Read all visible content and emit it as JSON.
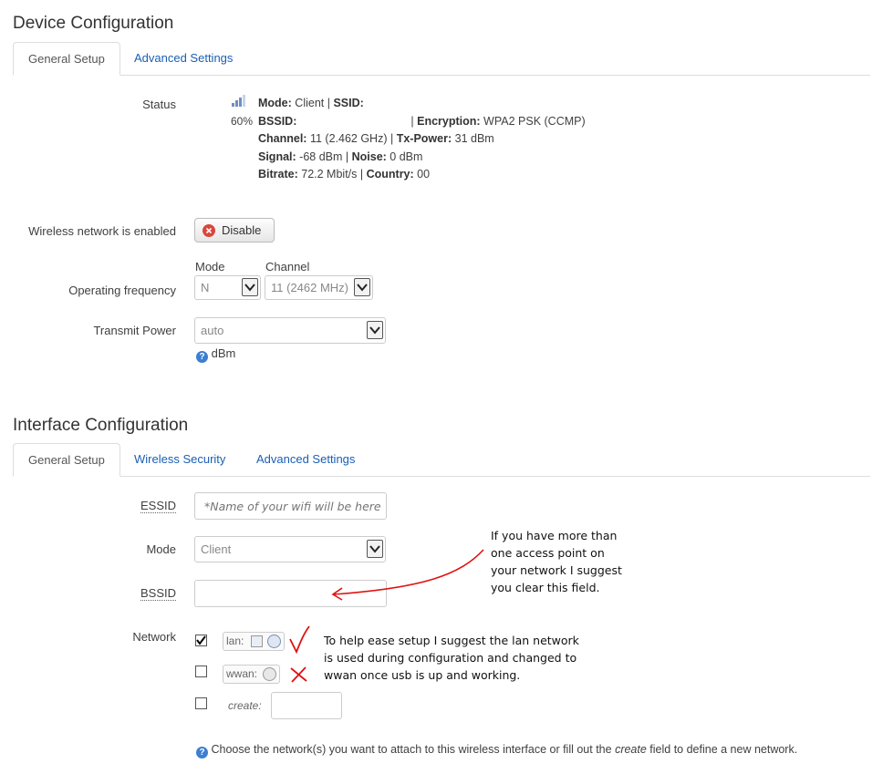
{
  "device": {
    "title": "Device Configuration",
    "tabs": [
      "General Setup",
      "Advanced Settings"
    ],
    "status": {
      "label": "Status",
      "signal_percent": "60%",
      "mode_label": "Mode:",
      "mode_value": "Client",
      "ssid_label": "SSID:",
      "bssid_label": "BSSID:",
      "encryption_label": "Encryption:",
      "encryption_value": "WPA2 PSK (CCMP)",
      "channel_label": "Channel:",
      "channel_value": "11 (2.462 GHz)",
      "txpower_label": "Tx-Power:",
      "txpower_value": "31 dBm",
      "signal_label": "Signal:",
      "signal_value": "-68 dBm",
      "noise_label": "Noise:",
      "noise_value": "0 dBm",
      "bitrate_label": "Bitrate:",
      "bitrate_value": "72.2 Mbit/s",
      "country_label": "Country:",
      "country_value": "00"
    },
    "wireless_enabled": {
      "label": "Wireless network is enabled",
      "button": "Disable"
    },
    "frequency": {
      "label": "Operating frequency",
      "mode_header": "Mode",
      "mode_value": "N",
      "channel_header": "Channel",
      "channel_value": "11 (2462 MHz)"
    },
    "transmit_power": {
      "label": "Transmit Power",
      "value": "auto",
      "unit": "dBm"
    }
  },
  "iface": {
    "title": "Interface Configuration",
    "tabs": [
      "General Setup",
      "Wireless Security",
      "Advanced Settings"
    ],
    "essid": {
      "label": "ESSID",
      "value": "*Name of your wifi will be here"
    },
    "mode": {
      "label": "Mode",
      "value": "Client"
    },
    "bssid": {
      "label": "BSSID",
      "value": ""
    },
    "network": {
      "label": "Network",
      "lan_label": "lan:",
      "wwan_label": "wwan:",
      "create_label": "create:",
      "hint_pre": "Choose the network(s) you want to attach to this wireless interface or fill out the ",
      "hint_em": "create",
      "hint_post": " field to define a new network."
    }
  },
  "annotations": {
    "bssid_note": [
      "If you have more than",
      "one access point on",
      "your network I suggest",
      "you clear this field."
    ],
    "lan_note": [
      "To help ease setup I suggest the lan network",
      "is used during configuration and changed to",
      "wwan once usb is up and working."
    ],
    "annotation_color": "#e01010"
  }
}
